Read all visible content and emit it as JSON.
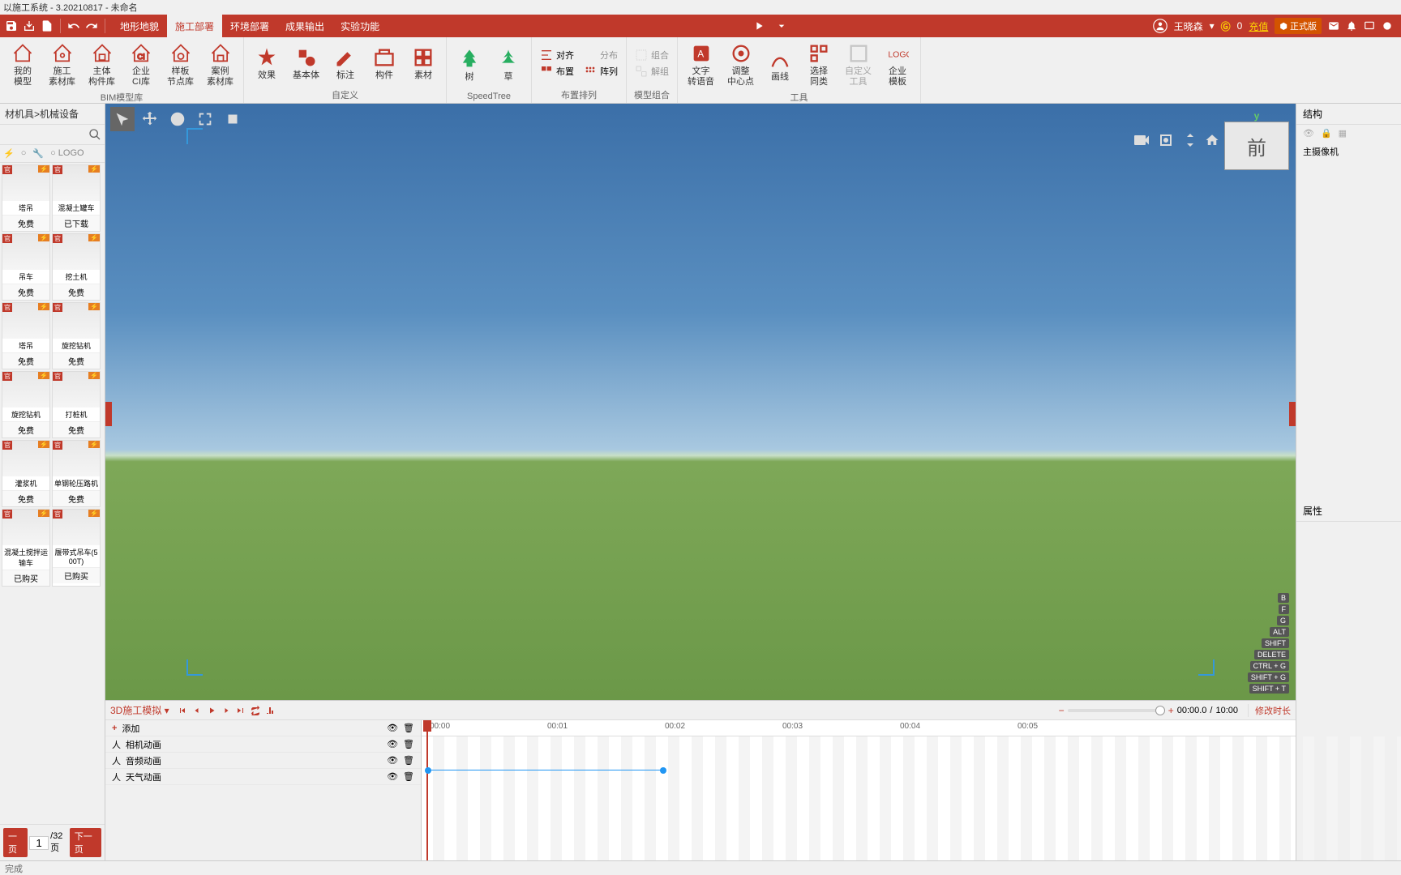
{
  "title": "以施工系统 - 3.20210817 - 未命名",
  "tabs": [
    "地形地貌",
    "施工部署",
    "环境部署",
    "成果输出",
    "实验功能"
  ],
  "active_tab": 1,
  "user": {
    "name": "王晓森",
    "coins": "0",
    "recharge": "充值",
    "version": "正式版"
  },
  "ribbon": {
    "groups": [
      {
        "label": "BIM模型库",
        "items": [
          "我的\n模型",
          "施工\n素材库",
          "主体\n构件库",
          "企业\nCI库",
          "样板\n节点库",
          "案例\n素材库"
        ]
      },
      {
        "label": "自定义",
        "items": [
          "效果",
          "基本体",
          "标注",
          "构件",
          "素材"
        ]
      },
      {
        "label": "SpeedTree",
        "items": [
          "树",
          "草"
        ]
      },
      {
        "label": "布置排列",
        "subs": [
          [
            "对齐",
            "分布"
          ],
          [
            "布置",
            "阵列"
          ]
        ]
      },
      {
        "label": "模型组合",
        "subs": [
          [
            "组合"
          ],
          [
            "解组"
          ]
        ]
      },
      {
        "label": "工具",
        "items": [
          "文字\n转语音",
          "调整\n中心点",
          "画线",
          "选择\n同类",
          "自定义\n工具",
          "企业\n模板"
        ]
      }
    ]
  },
  "left": {
    "breadcrumb": "材机具>机械设备",
    "logo_tab": "LOGO",
    "assets": [
      {
        "name": "塔吊",
        "price": "免费"
      },
      {
        "name": "混凝土罐车",
        "price": "已下载"
      },
      {
        "name": "吊车",
        "price": "免费"
      },
      {
        "name": "挖土机",
        "price": "免费"
      },
      {
        "name": "塔吊",
        "price": "免费"
      },
      {
        "name": "旋挖钻机",
        "price": "免费"
      },
      {
        "name": "旋挖钻机",
        "price": "免费"
      },
      {
        "name": "打桩机",
        "price": "免费"
      },
      {
        "name": "灌浆机",
        "price": "免费"
      },
      {
        "name": "单钢轮压路机",
        "price": "免费"
      },
      {
        "name": "混凝土搅拌运\n输车",
        "price": "已购买"
      },
      {
        "name": "履带式吊车(5\n00T)",
        "price": "已购买"
      }
    ],
    "pager": {
      "prev": "一页",
      "page": "1",
      "total": "/32页",
      "next": "下一页"
    }
  },
  "viewport": {
    "cube": "前",
    "shortcuts": [
      "B",
      "F",
      "G",
      "ALT",
      "SHIFT",
      "DELETE",
      "CTRL + G",
      "SHIFT + G",
      "SHIFT + T"
    ]
  },
  "timeline": {
    "title": "3D施工模拟 ▾",
    "current": "00:00.0",
    "total": "10:00",
    "edit": "修改时长",
    "add": "添加",
    "tracks": [
      "相机动画",
      "音频动画",
      "天气动画"
    ],
    "ticks": [
      "00:00",
      "00:01",
      "00:02",
      "00:03",
      "00:04",
      "00:05"
    ]
  },
  "right": {
    "structure": "结构",
    "camera": "主摄像机",
    "properties": "属性"
  },
  "status": "完成"
}
